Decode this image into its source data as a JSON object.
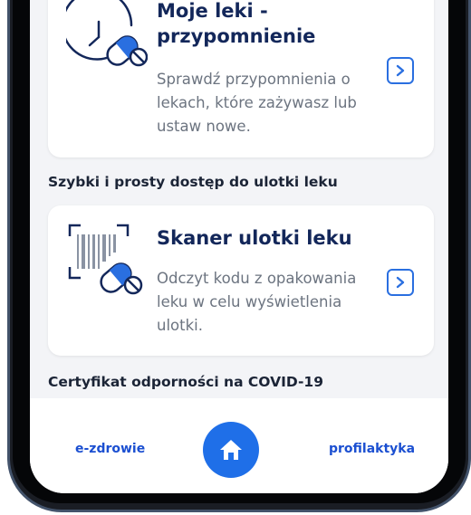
{
  "cards": [
    {
      "title_line1": "Moje leki -",
      "title_line2": "przypomnienie",
      "desc_line1": "Sprawdź przypomnienia o",
      "desc_line2": "lekach, które zażywasz lub",
      "desc_line3": "ustaw nowe."
    },
    {
      "title_line1": "Skaner ulotki leku",
      "desc_line1": "Odczyt kodu z opakowania",
      "desc_line2": "leku w celu wyświetlenia",
      "desc_line3": "ulotki."
    }
  ],
  "sections": {
    "scanner_heading": "Szybki i prosty dostęp do ulotki leku",
    "covid_heading": "Certyfikat odporności na COVID-19"
  },
  "bottom_nav": {
    "left_label": "e-zdrowie",
    "right_label": "profilaktyka",
    "home_icon": "home-icon"
  },
  "colors": {
    "accent": "#1f6fe8",
    "title": "#13275a",
    "body_text": "#6c7480",
    "screen_bg": "#f3f4f7"
  }
}
